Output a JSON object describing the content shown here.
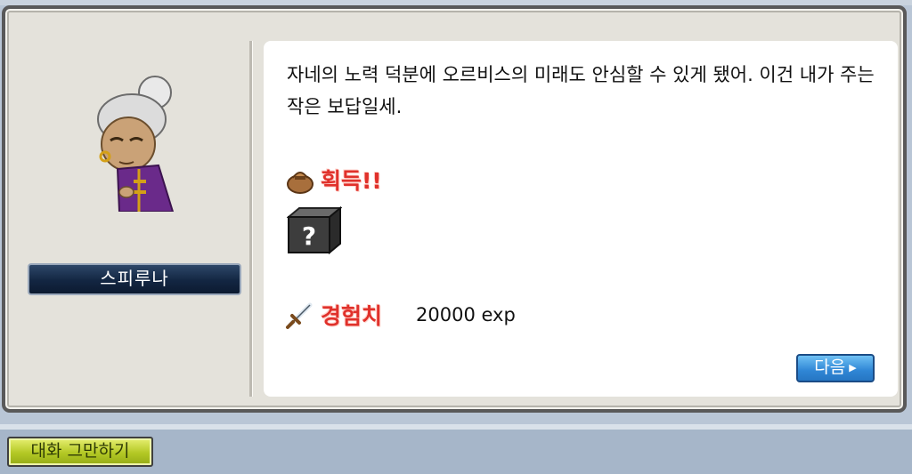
{
  "npc": {
    "name": "스피루나"
  },
  "dialog": {
    "message": "자네의 노력 덕분에 오르비스의 미래도 안심할 수 있게 됐어. 이건 내가 주는 작은 보답일세."
  },
  "rewards": {
    "obtain_label": "획득!!",
    "item_icon": "mystery-box-icon",
    "exp_label": "경험치",
    "exp_value": "20000 exp"
  },
  "buttons": {
    "next_label": "다음",
    "end_chat_label": "대화 그만하기"
  },
  "colors": {
    "reward_label_red": "#e0312b",
    "next_button_blue": "#2f86d5",
    "end_button_green": "#b3c824",
    "name_plate_navy": "#132642"
  }
}
